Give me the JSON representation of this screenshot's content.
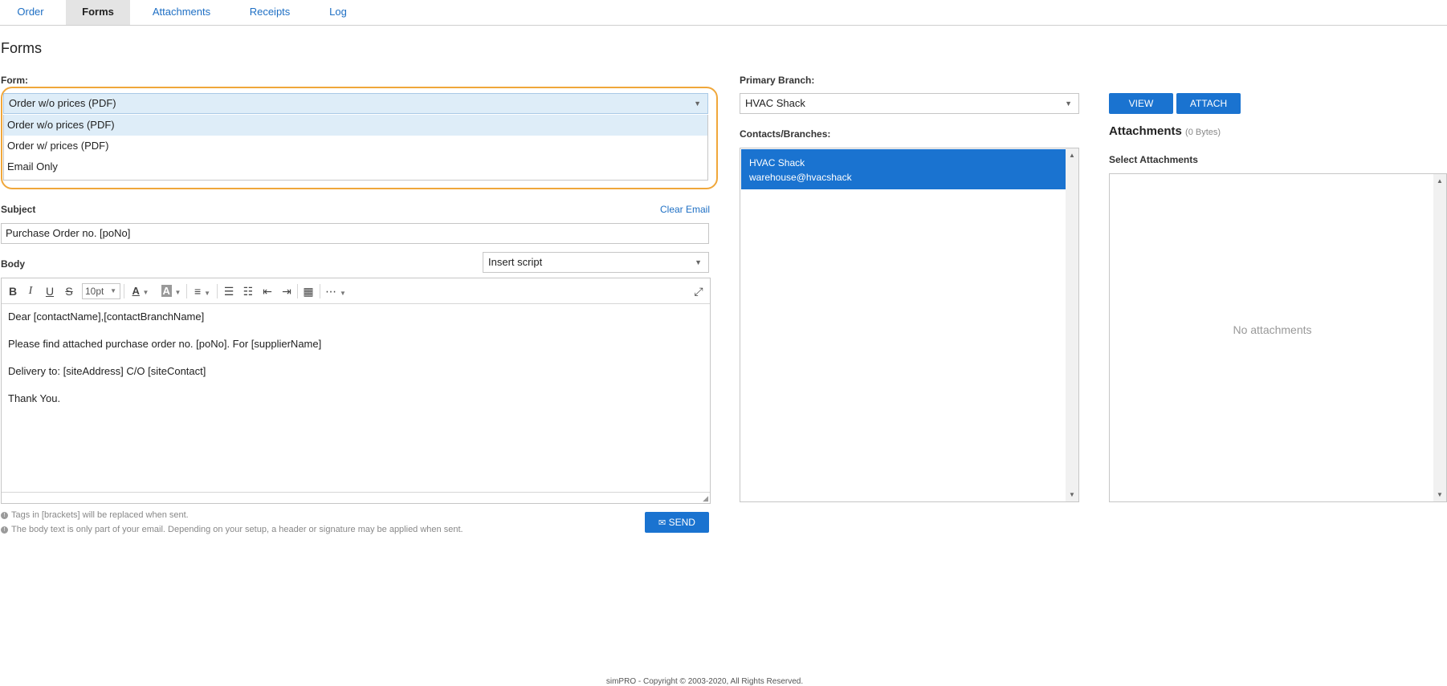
{
  "tabs": [
    "Order",
    "Forms",
    "Attachments",
    "Receipts",
    "Log"
  ],
  "page_title": "Forms",
  "form": {
    "label": "Form:",
    "selected": "Order w/o prices (PDF)",
    "options": [
      "Order w/o prices (PDF)",
      "Order w/ prices (PDF)",
      "Email Only"
    ]
  },
  "subject": {
    "label": "Subject",
    "clear_email": "Clear Email",
    "value": "Purchase Order no. [poNo]"
  },
  "body": {
    "label": "Body",
    "insert_script": "Insert script",
    "font_size": "10pt",
    "lines": [
      "Dear [contactName],[contactBranchName]",
      "Please find attached purchase order no. [poNo]. For [supplierName]",
      "Delivery to: [siteAddress] C/O [siteContact]",
      "Thank You."
    ]
  },
  "notes": [
    "Tags in [brackets] will be replaced when sent.",
    "The body text is only part of your email. Depending on your setup, a header or signature may be applied when sent."
  ],
  "send_label": "SEND",
  "primary_branch": {
    "label": "Primary Branch:",
    "value": "HVAC Shack"
  },
  "contacts": {
    "label": "Contacts/Branches:",
    "items": [
      {
        "name": "HVAC Shack",
        "email": "warehouse@hvacshack"
      }
    ]
  },
  "buttons": {
    "view": "VIEW",
    "attach": "ATTACH"
  },
  "attachments": {
    "title": "Attachments",
    "size": "(0 Bytes)",
    "select_label": "Select Attachments",
    "empty_text": "No attachments"
  },
  "footer": "simPRO - Copyright © 2003-2020, All Rights Reserved.",
  "colors": {
    "accent": "#1a73d0",
    "link": "#1e6fc4",
    "focus_ring": "#f0a73a",
    "selected_option_bg": "#deedf8"
  }
}
